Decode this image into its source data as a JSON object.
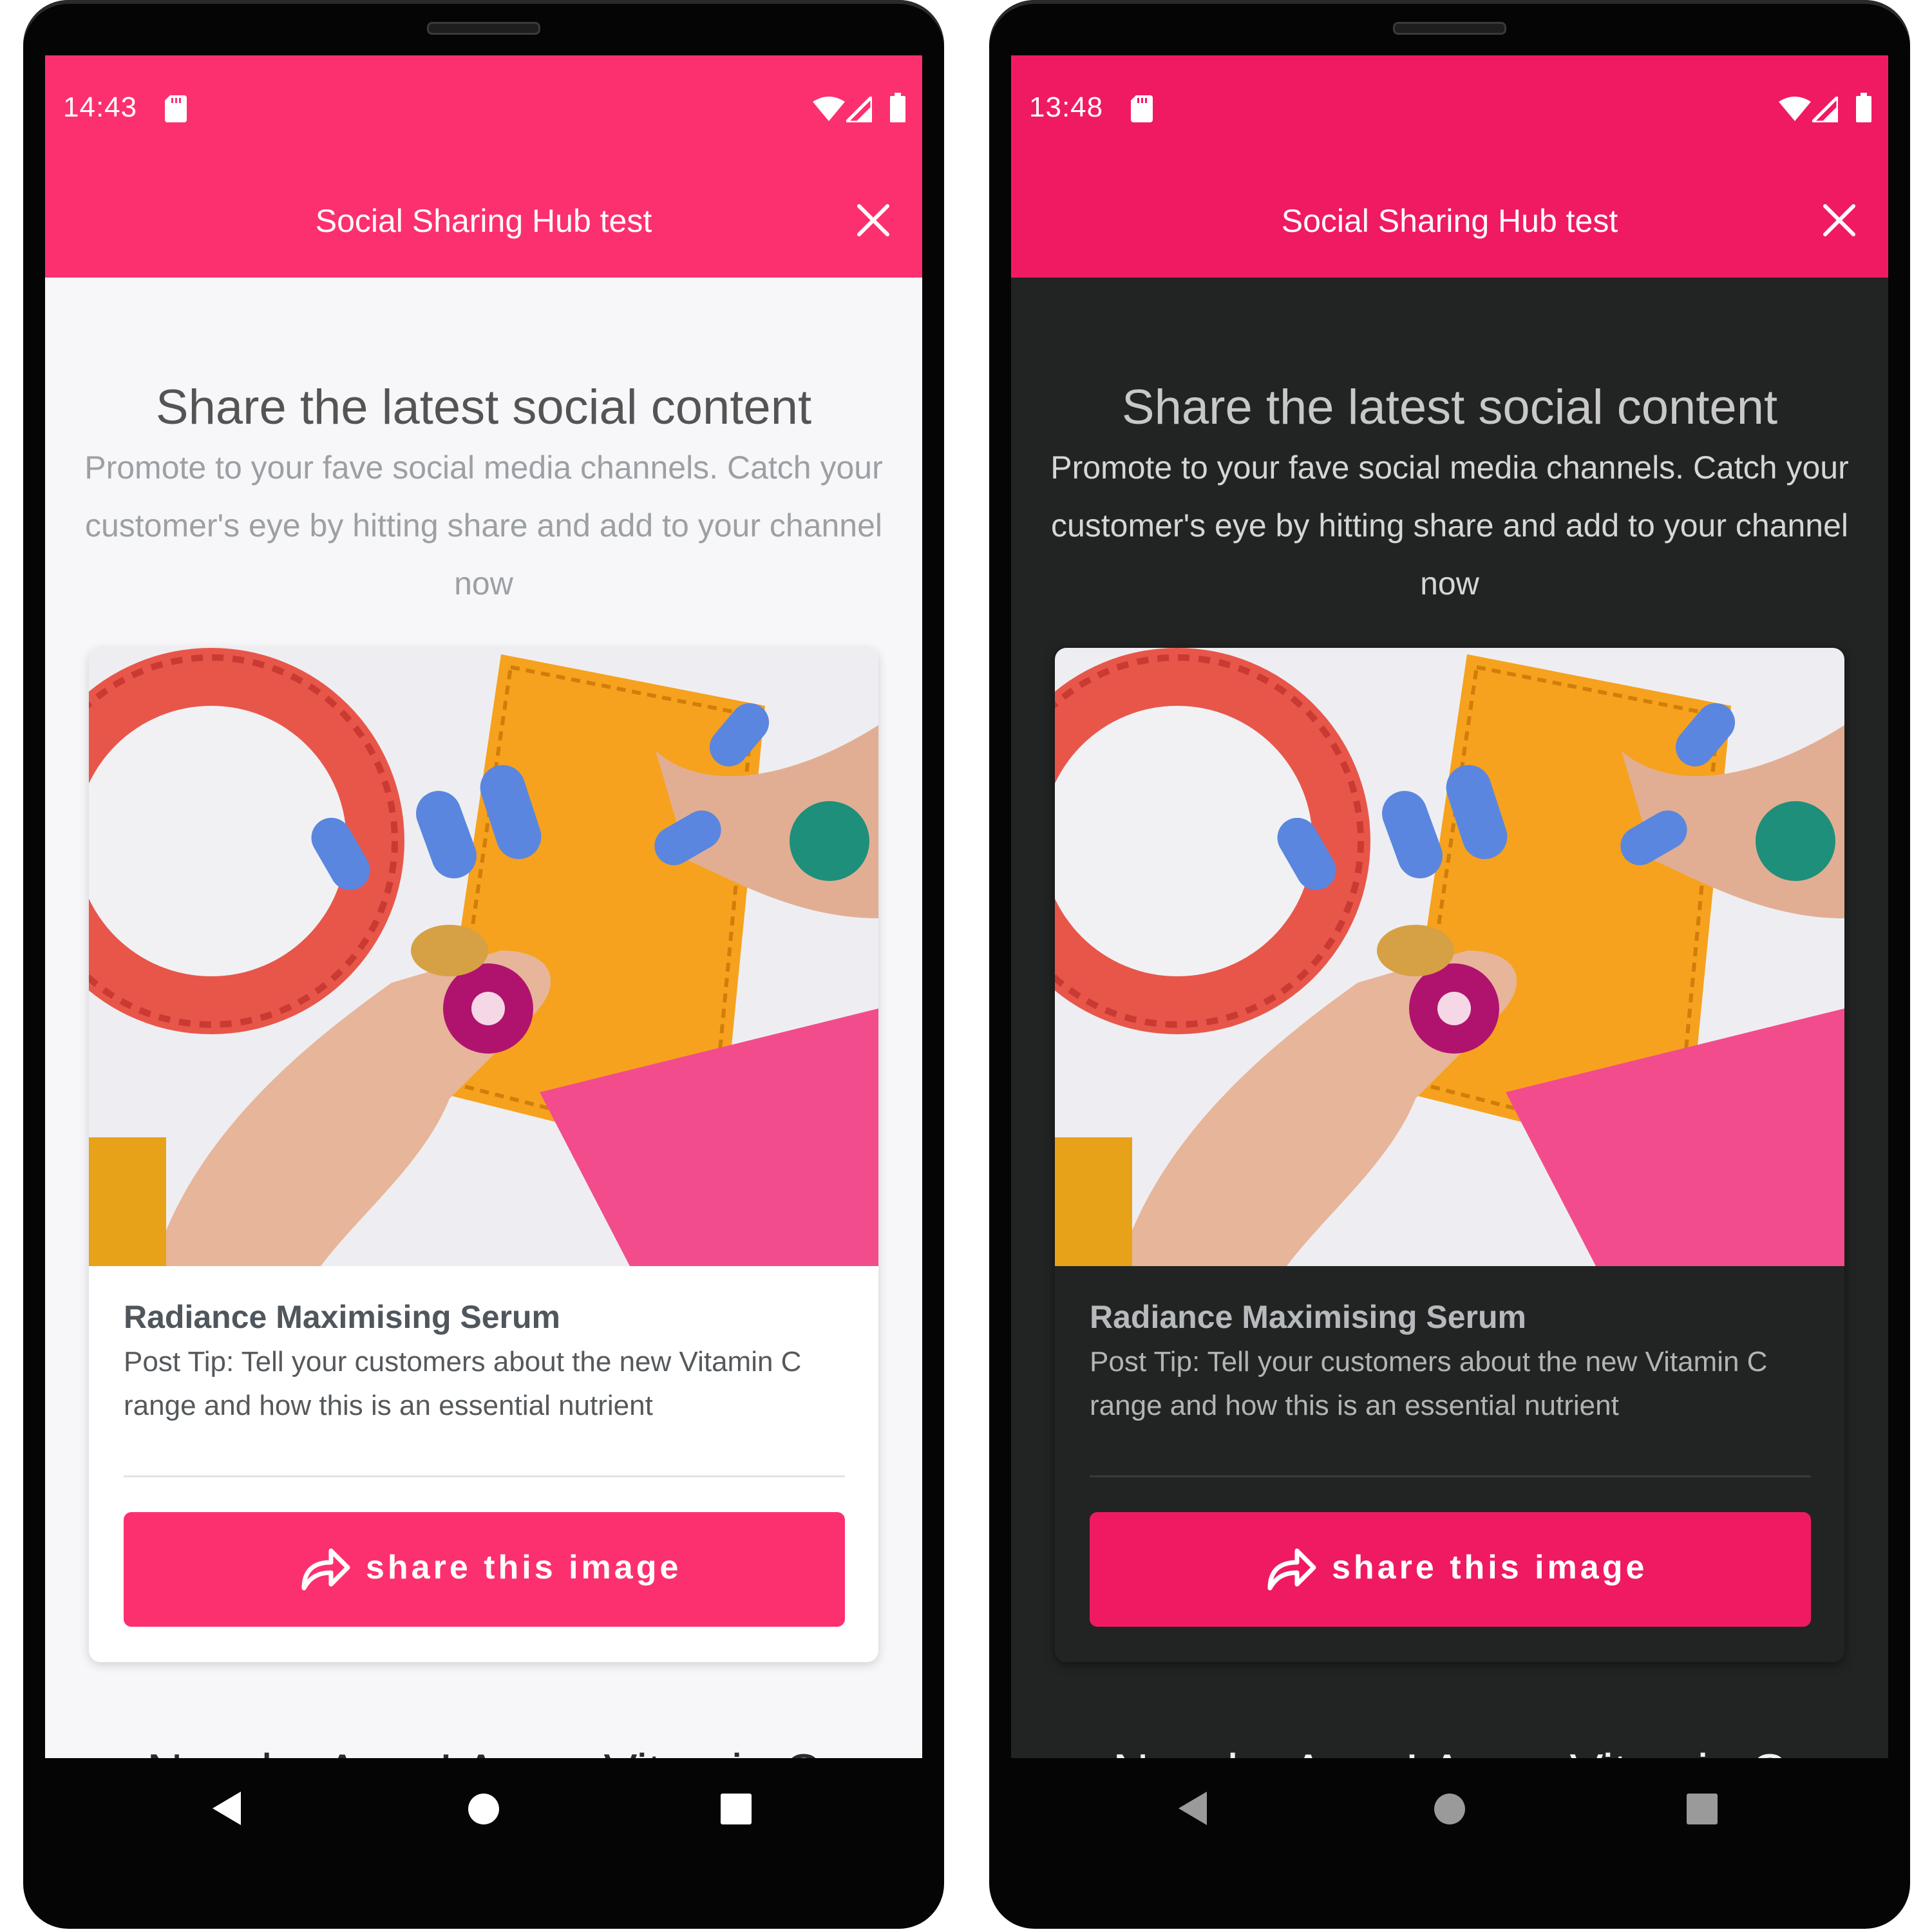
{
  "screens": [
    {
      "theme": "light",
      "status": {
        "time": "14:43"
      },
      "appbar": {
        "title": "Social Sharing Hub test"
      },
      "content": {
        "headline": "Share the latest social content",
        "subtext": "Promote to your fave social media channels. Catch your customer's eye by hitting share and add to your channel now",
        "card": {
          "image_description_icon": "product-photo",
          "title": "Radiance Maximising Serum",
          "tip": "Post Tip: Tell your customers about the new Vitamin C range and how this is an essential nutrient",
          "share_label": "share this image"
        },
        "next_heading": "New by Avon! Anew Vitamin C"
      }
    },
    {
      "theme": "dark",
      "status": {
        "time": "13:48"
      },
      "appbar": {
        "title": "Social Sharing Hub test"
      },
      "content": {
        "headline": "Share the latest social content",
        "subtext": "Promote to your fave social media channels. Catch your customer's eye by hitting share and add to your channel now",
        "card": {
          "image_description_icon": "product-photo",
          "title": "Radiance Maximising Serum",
          "tip": "Post Tip: Tell your customers about the new Vitamin C range and how this is an essential nutrient",
          "share_label": "share this image"
        },
        "next_heading": "New by Avon! Anew Vitamin C"
      }
    }
  ],
  "colors": {
    "brand_pink_light": "#fd306f",
    "brand_pink_dark": "#f01a63",
    "dark_background": "#222424",
    "light_background": "#f7f7f9"
  }
}
